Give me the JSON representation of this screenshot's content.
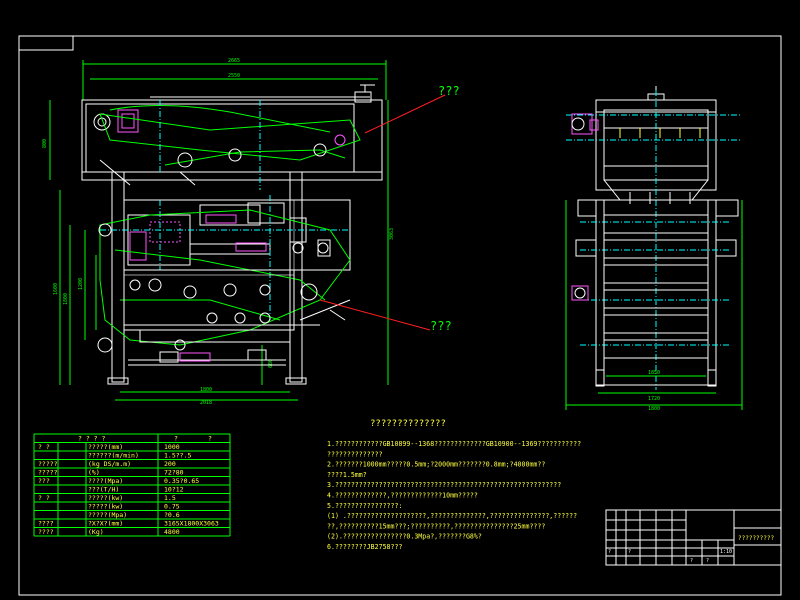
{
  "colors": {
    "background": "#000000",
    "frame": "#ffffff",
    "machine": "#ffffff",
    "centerline": "#00ffff",
    "dimension": "#00ff00",
    "belt": "#00ff00",
    "leader": "#ff2020",
    "accent": "#ff55ff",
    "yellow": "#ffff40",
    "table_grid": "#00ff00",
    "table_text": "#ffff40",
    "notes_text": "#ffff40",
    "title_block": "#ffffff"
  },
  "callouts": {
    "top": "???",
    "bottom": "???"
  },
  "dims": {
    "top_overall": "2665",
    "top_inner": "2550",
    "left_upper": "800",
    "left_mid": "1600",
    "left_lower": "1800",
    "left_lower2": "1200",
    "right_height": "3063",
    "small_right": "680",
    "bottom_inner": "1800",
    "bottom_outer": "2018",
    "side_inner": "1850",
    "side_mid": "1720",
    "side_outer": "1800"
  },
  "spec_table": {
    "header": [
      "? ? ? ?",
      "?",
      "?"
    ],
    "rows": [
      {
        "group": "? ?",
        "item": "?????(mm)",
        "value": "1000"
      },
      {
        "group": "",
        "item": "??????(m/min)",
        "value": "1.5??.5"
      },
      {
        "group": "?????",
        "item": "(kg DS/m.m)",
        "value": "200"
      },
      {
        "group": "?????",
        "item": "(%)",
        "value": "72?80"
      },
      {
        "group": "???",
        "item": "????(Mpa)",
        "value": "0.35?0.65"
      },
      {
        "group": "",
        "item": "???(T/H)",
        "value": "10?12"
      },
      {
        "group": "? ?",
        "item": "?????(kw)",
        "value": "1.5"
      },
      {
        "group": "",
        "item": "?????(kw)",
        "value": "0.75"
      },
      {
        "group": "",
        "item": "?????(Mpa)",
        "value": "?0.6"
      },
      {
        "group": "????",
        "item": "?X?X?(mm)",
        "value": "3165X1800X3063"
      },
      {
        "group": "????",
        "item": "(Kg)",
        "value": "4800"
      }
    ]
  },
  "notes": {
    "title": "??????????????",
    "lines": [
      "1.????????????GB10899--1368?????????????GB10900--1369???????????",
      "  ??????????????",
      "2.???????1000mm?????0.5mm;?2000mm???????0.8mm;?4000mm??",
      "  ????1.5mm?",
      "3.?????????????????????????????????????????????????????????",
      "4.?????????????,?????????????10mm?????",
      "5.????????????????:",
      "   (1) .????????????????????,??????????????,???????????????,??????",
      "  ??,??????????15mm???;??????????,???????????????25mm????",
      "   (2).????????????????0.3Mpa?,???????G8%?",
      "6.????????JB2758???"
    ]
  },
  "title_block": {
    "drawing_name": "??????????",
    "small": [
      "?",
      "?",
      "?",
      "?",
      "1:10"
    ]
  }
}
